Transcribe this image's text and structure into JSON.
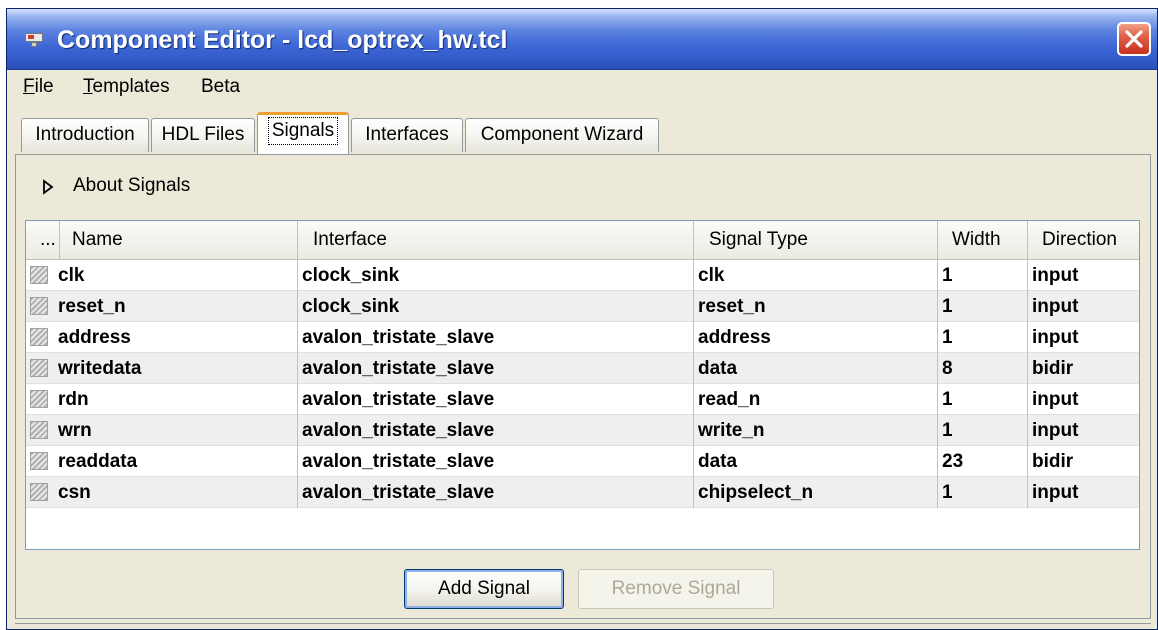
{
  "window": {
    "title": "Component Editor - lcd_optrex_hw.tcl"
  },
  "menu": [
    {
      "mnemonic": "F",
      "rest": "ile"
    },
    {
      "mnemonic": "T",
      "rest": "emplates"
    },
    {
      "mnemonic": "",
      "rest": "Beta"
    }
  ],
  "tabs": [
    {
      "label": "Introduction"
    },
    {
      "label": "HDL Files"
    },
    {
      "label": "Signals"
    },
    {
      "label": "Interfaces"
    },
    {
      "label": "Component Wizard"
    }
  ],
  "active_tab": "Signals",
  "about": {
    "label": "About Signals"
  },
  "table": {
    "headers": [
      "...",
      "Name",
      "Interface",
      "Signal Type",
      "Width",
      "Direction"
    ],
    "rows": [
      {
        "name": "clk",
        "interface": "clock_sink",
        "type": "clk",
        "width": "1",
        "direction": "input"
      },
      {
        "name": "reset_n",
        "interface": "clock_sink",
        "type": "reset_n",
        "width": "1",
        "direction": "input"
      },
      {
        "name": "address",
        "interface": "avalon_tristate_slave",
        "type": "address",
        "width": "1",
        "direction": "input"
      },
      {
        "name": "writedata",
        "interface": "avalon_tristate_slave",
        "type": "data",
        "width": "8",
        "direction": "bidir"
      },
      {
        "name": "rdn",
        "interface": "avalon_tristate_slave",
        "type": "read_n",
        "width": "1",
        "direction": "input"
      },
      {
        "name": "wrn",
        "interface": "avalon_tristate_slave",
        "type": "write_n",
        "width": "1",
        "direction": "input"
      },
      {
        "name": "readdata",
        "interface": "avalon_tristate_slave",
        "type": "data",
        "width": "23",
        "direction": "bidir"
      },
      {
        "name": "csn",
        "interface": "avalon_tristate_slave",
        "type": "chipselect_n",
        "width": "1",
        "direction": "input"
      }
    ]
  },
  "buttons": {
    "add": "Add Signal",
    "remove": "Remove Signal"
  },
  "icons": {
    "app": "monitor-icon",
    "close": "close-icon",
    "expander": "triangle-right-icon",
    "row_handle": "grip-icon"
  },
  "colors": {
    "titlebar": "#3f69d6",
    "close_button": "#e2614a",
    "active_tab_accent": "#f0a030",
    "panel_bg": "#ece9d8"
  }
}
